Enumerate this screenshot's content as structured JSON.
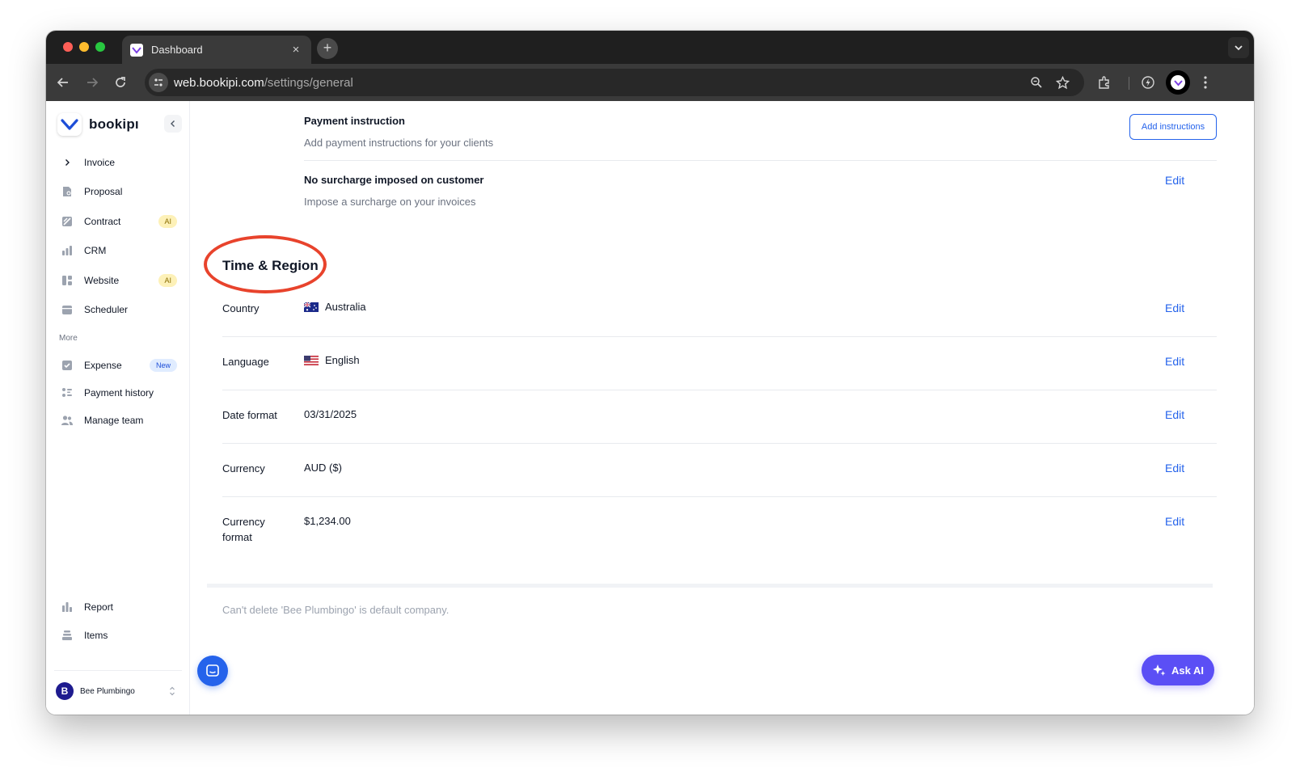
{
  "browser": {
    "tab_title": "Dashboard",
    "tab_close": "×",
    "new_tab": "+",
    "url_host": "web.bookipi.com",
    "url_path": "/settings/general"
  },
  "sidebar": {
    "brand": "bookipı",
    "items": [
      {
        "label": "Invoice",
        "icon": "chevron-right-icon"
      },
      {
        "label": "Proposal",
        "icon": "proposal-icon"
      },
      {
        "label": "Contract",
        "icon": "contract-icon",
        "badge": "AI"
      },
      {
        "label": "CRM",
        "icon": "crm-icon"
      },
      {
        "label": "Website",
        "icon": "website-icon",
        "badge": "AI"
      },
      {
        "label": "Scheduler",
        "icon": "scheduler-icon"
      }
    ],
    "more_label": "More",
    "more_items": [
      {
        "label": "Expense",
        "icon": "expense-icon",
        "badge": "New"
      },
      {
        "label": "Payment history",
        "icon": "payment-history-icon"
      },
      {
        "label": "Manage team",
        "icon": "team-icon"
      }
    ],
    "bottom_items": [
      {
        "label": "Report",
        "icon": "report-icon"
      },
      {
        "label": "Items",
        "icon": "items-icon"
      }
    ],
    "company": {
      "avatar": "B",
      "name": "Bee Plumbingo"
    }
  },
  "payment": {
    "instruction_title": "Payment instruction",
    "instruction_desc": "Add payment instructions for your clients",
    "add_button": "Add instructions",
    "surcharge_title": "No surcharge imposed on customer",
    "surcharge_desc": "Impose a surcharge on your invoices",
    "edit": "Edit"
  },
  "time_region": {
    "title": "Time & Region",
    "rows": [
      {
        "label": "Country",
        "value": "Australia",
        "flag": "australia-flag-icon",
        "action": "Edit"
      },
      {
        "label": "Language",
        "value": "English",
        "flag": "us-flag-icon",
        "action": "Edit"
      },
      {
        "label": "Date format",
        "value": "03/31/2025",
        "action": "Edit"
      },
      {
        "label": "Currency",
        "value": "AUD ($)",
        "action": "Edit"
      },
      {
        "label": "Currency",
        "label2": "format",
        "value": "$1,234.00",
        "action": "Edit"
      }
    ]
  },
  "footer_note": "Can't delete 'Bee Plumbingo' is default company.",
  "ask_ai": "Ask AI",
  "colors": {
    "accent": "#2563eb",
    "ask_ai": "#5b4ff5",
    "highlight": "#e8432c",
    "ai_badge_bg": "#fdf1b8",
    "new_badge_bg": "#e0ecff"
  }
}
